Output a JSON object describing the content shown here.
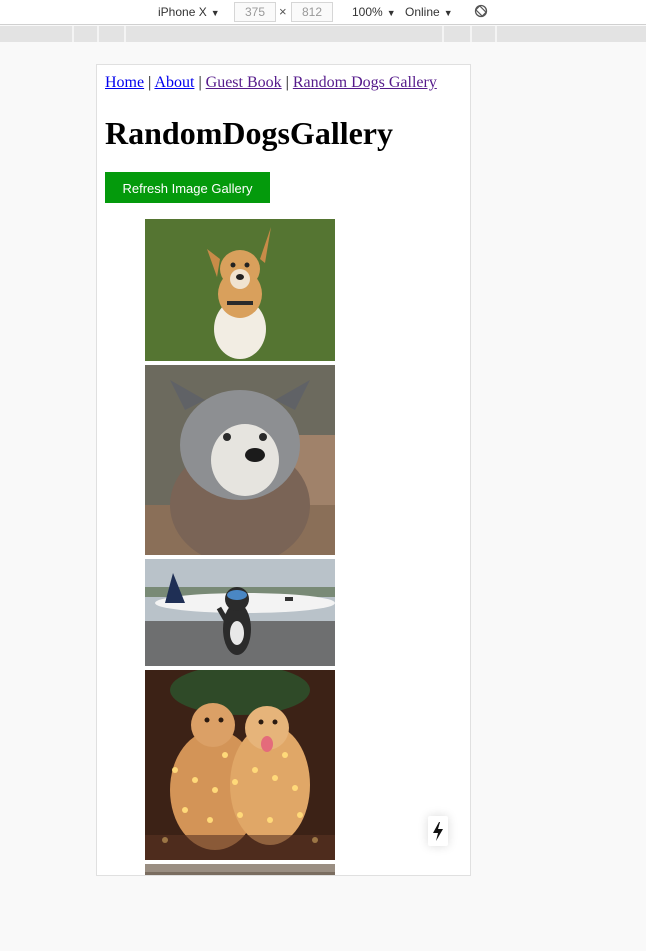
{
  "devtools": {
    "device": "iPhone X",
    "width": "375",
    "height": "812",
    "zoom": "100%",
    "network": "Online"
  },
  "nav": {
    "links": [
      "Home",
      "About",
      "Guest Book",
      "Random Dogs Gallery"
    ],
    "separator": "|"
  },
  "page": {
    "title": "RandomDogsGallery",
    "refresh_label": "Refresh Image Gallery"
  },
  "gallery": {
    "images": [
      {
        "name": "dog-photo-tan-on-grass"
      },
      {
        "name": "dog-photo-husky-on-wood"
      },
      {
        "name": "dog-photo-husky-with-airplane"
      },
      {
        "name": "dog-photo-golden-retrievers-lights"
      },
      {
        "name": "dog-photo-partial"
      }
    ]
  },
  "colors": {
    "button_bg": "#049a0c",
    "link": "#0000ee",
    "visited_link": "#551a8b"
  }
}
